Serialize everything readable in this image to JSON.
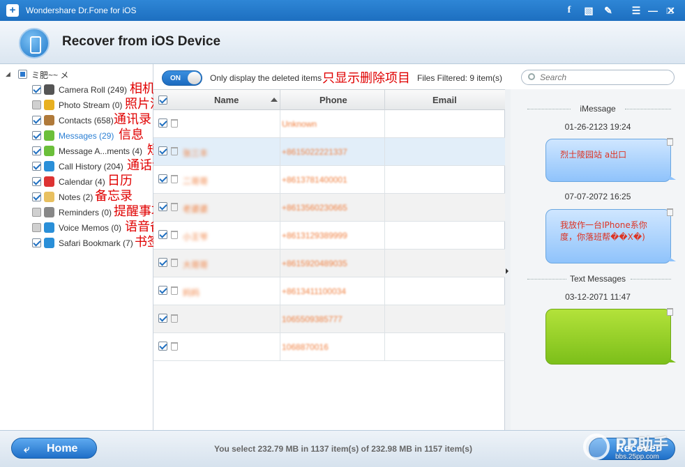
{
  "titlebar": {
    "app_title": "Wondershare Dr.Fone for iOS",
    "icons": [
      "facebook-icon",
      "chat-icon",
      "feedback-icon",
      "menu-icon",
      "minimize-icon",
      "maximize-icon",
      "close-icon"
    ]
  },
  "header": {
    "title": "Recover from iOS Device"
  },
  "sidebar": {
    "root_label": "ミ肥~~ メ",
    "items": [
      {
        "label": "Camera Roll (249)",
        "annotation": "相机胶卷",
        "checked": "on",
        "icon_color": "#555"
      },
      {
        "label": "Photo Stream (0)",
        "annotation": "照片流媒体",
        "checked": "off",
        "icon_color": "#e8b020"
      },
      {
        "label": "Contacts (658)",
        "annotation": "通讯录",
        "checked": "on",
        "icon_color": "#b07a3a"
      },
      {
        "label": "Messages (29)",
        "annotation": "信息",
        "checked": "on",
        "icon_color": "#6bbf3a"
      },
      {
        "label": "Message A...ments (4)",
        "annotation": "短信附带照片",
        "checked": "on",
        "icon_color": "#6bbf3a"
      },
      {
        "label": "Call History (204)",
        "annotation": "通话记录",
        "checked": "on",
        "icon_color": "#2a8fd8"
      },
      {
        "label": "Calendar (4)",
        "annotation": "日历",
        "checked": "on",
        "icon_color": "#d33"
      },
      {
        "label": "Notes (2)",
        "annotation": "备忘录",
        "checked": "on",
        "icon_color": "#e8c060"
      },
      {
        "label": "Reminders (0)",
        "annotation": "提醒事项",
        "checked": "off",
        "icon_color": "#888"
      },
      {
        "label": "Voice Memos (0)",
        "annotation": "语音备忘录",
        "checked": "off",
        "icon_color": "#2a8fd8"
      },
      {
        "label": "Safari Bookmark (7)",
        "annotation": "书签",
        "checked": "on",
        "icon_color": "#2a8fd8"
      }
    ]
  },
  "toolbar": {
    "toggle_label": "ON",
    "only_deleted_label": "Only display the deleted items",
    "only_deleted_annotation": "只显示删除项目",
    "files_filtered": "Files Filtered: 9 item(s)",
    "search_placeholder": "Search"
  },
  "table": {
    "headers": {
      "name": "Name",
      "phone": "Phone",
      "email": "Email"
    },
    "rows": [
      {
        "name": "",
        "phone": "Unknown"
      },
      {
        "name": "张三丰",
        "phone": "+8615022221337"
      },
      {
        "name": "二哥哥",
        "phone": "+8613781400001"
      },
      {
        "name": "老婆婆",
        "phone": "+8613560230665"
      },
      {
        "name": "小王爷",
        "phone": "+8613129389999"
      },
      {
        "name": "大哥哥",
        "phone": "+8615920489035"
      },
      {
        "name": "妈妈",
        "phone": "+8613411100034"
      },
      {
        "name": "",
        "phone": "1065509385777"
      },
      {
        "name": "",
        "phone": "1068870016"
      }
    ]
  },
  "preview": {
    "imessage_label": "iMessage",
    "text_messages_label": "Text Messages",
    "messages": [
      {
        "timestamp": "01-26-2123 19:24",
        "text": "烈士陵园站  a出口",
        "style": "blue"
      },
      {
        "timestamp": "07-07-2072 16:25",
        "text": "我放作一台IPhone系你度，你落班帮��X�)",
        "style": "blue"
      },
      {
        "timestamp": "03-12-2071 11:47",
        "text": "",
        "style": "green"
      }
    ]
  },
  "footer": {
    "home_label": "Home",
    "select_status": "You select 232.79 MB in 1137 item(s) of 232.98 MB in 1157 item(s)",
    "recover_label": "Recover",
    "watermark_brand": "PP助手",
    "watermark_url": "bbs.25pp.com"
  },
  "colors": {
    "accent": "#1f6fc8",
    "annotation_red": "#e00000",
    "contact_orange": "#f08040",
    "bubble_green": "#7cbf1a"
  }
}
